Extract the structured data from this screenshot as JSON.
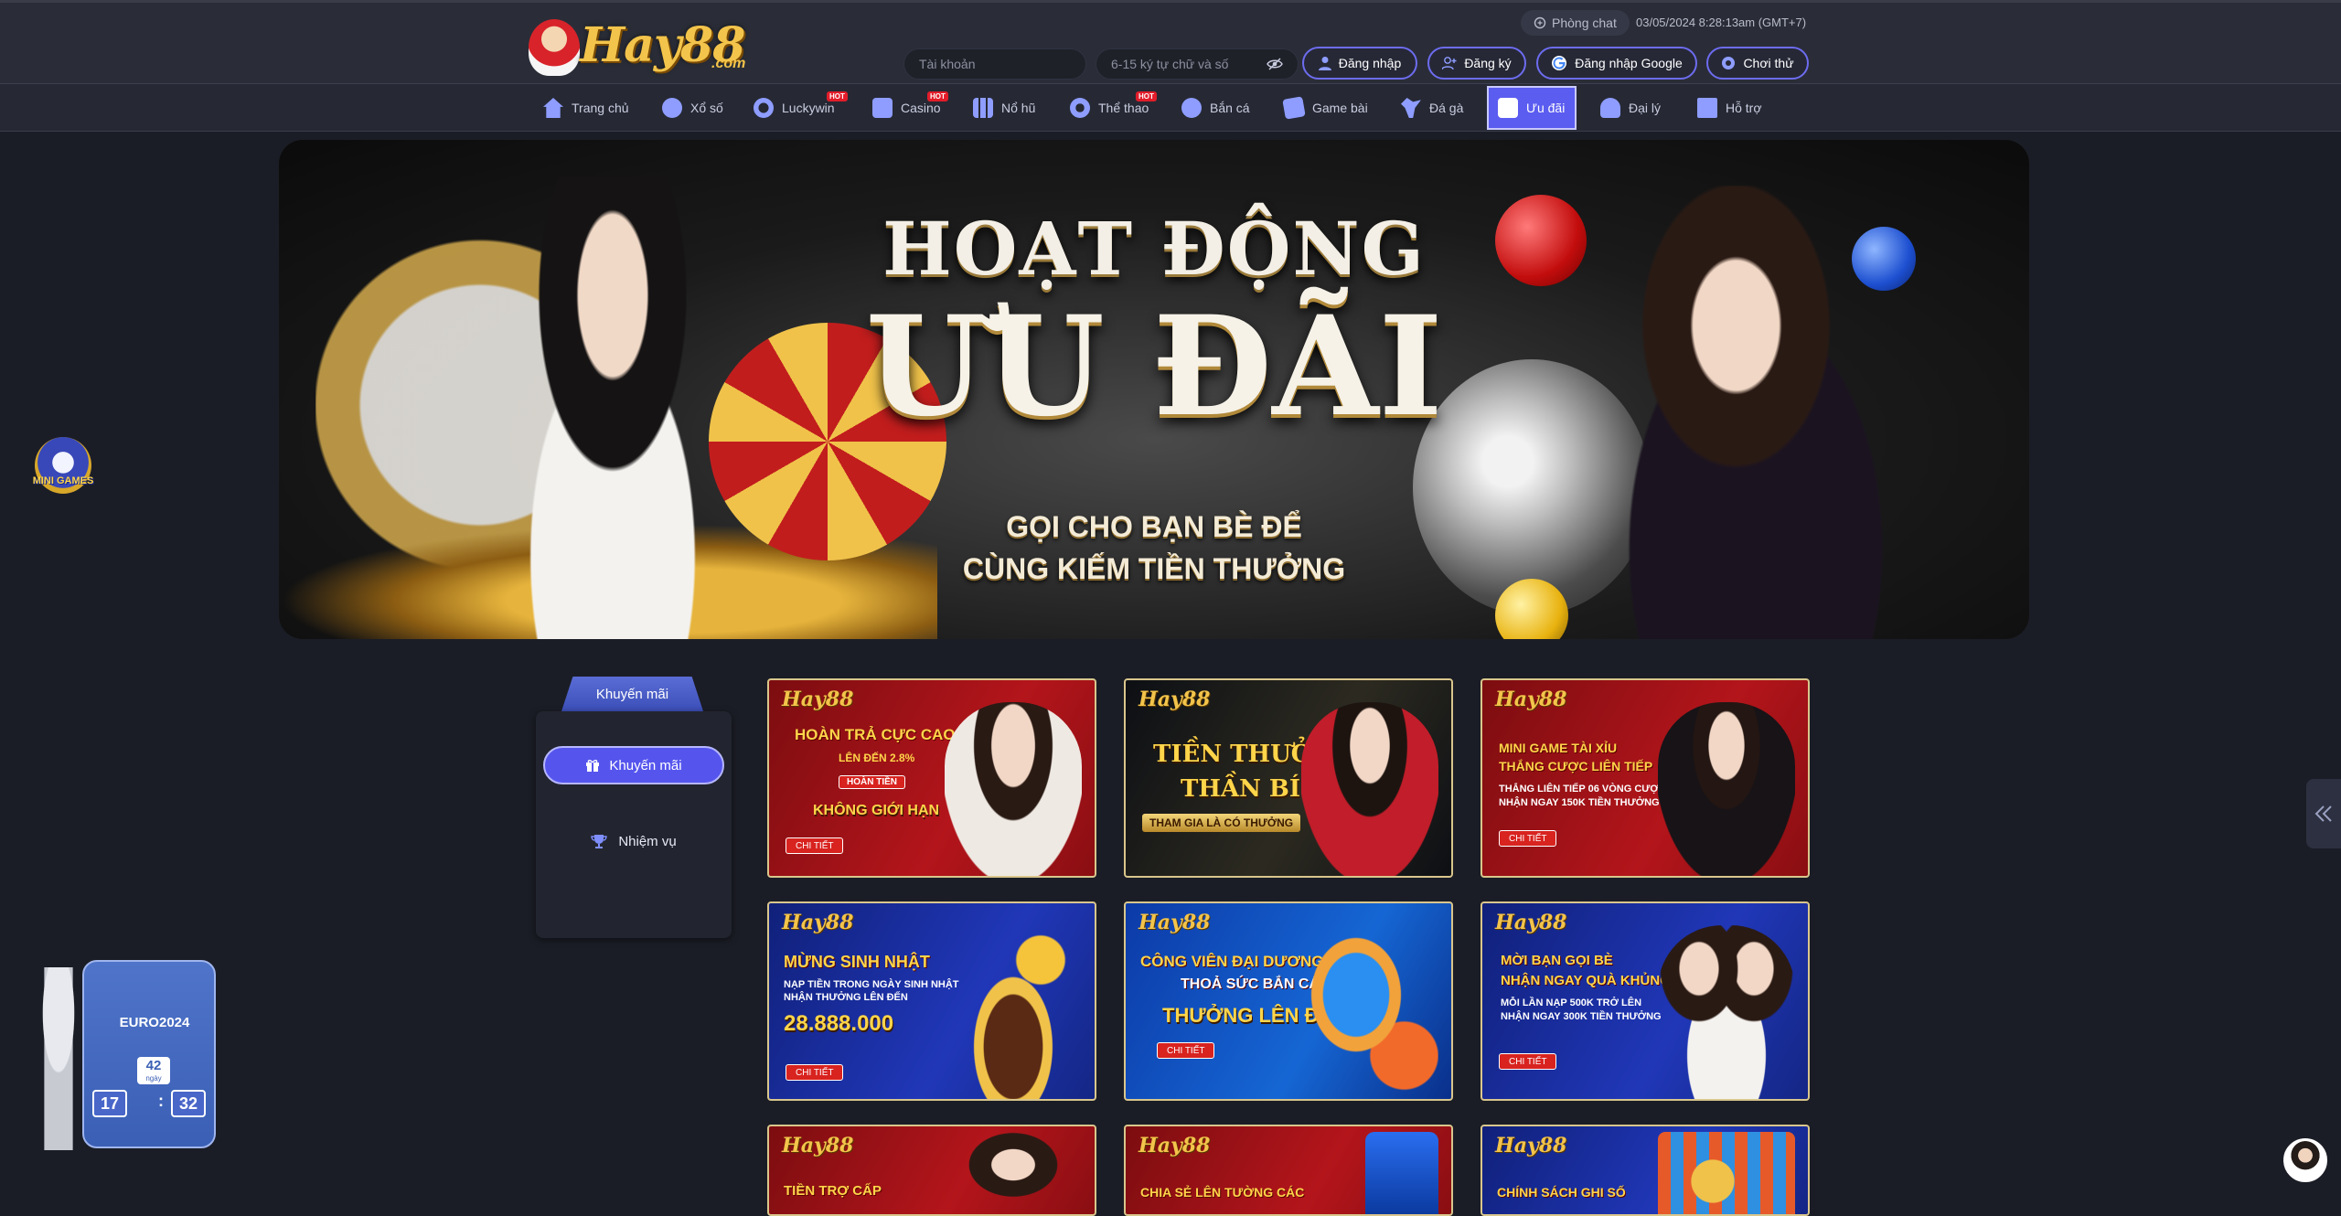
{
  "header": {
    "logo_text": "Hay88",
    "logo_domain": ".com",
    "chat_label": "Phòng chat",
    "clock": "03/05/2024 8:28:13am  (GMT+7)",
    "username_placeholder": "Tài khoản",
    "password_placeholder": "6-15 ký tự chữ và số",
    "login_label": "Đăng nhập",
    "register_label": "Đăng ký",
    "google_label": "Đăng nhập Google",
    "trial_label": "Chơi thử"
  },
  "nav": {
    "items": [
      {
        "label": "Trang chủ",
        "hot": false
      },
      {
        "label": "Xổ số",
        "hot": false
      },
      {
        "label": "Luckywin",
        "hot": true
      },
      {
        "label": "Casino",
        "hot": true
      },
      {
        "label": "Nổ hũ",
        "hot": false
      },
      {
        "label": "Thể thao",
        "hot": true
      },
      {
        "label": "Bắn cá",
        "hot": false
      },
      {
        "label": "Game bài",
        "hot": false
      },
      {
        "label": "Đá gà",
        "hot": false
      },
      {
        "label": "Ưu đãi",
        "hot": false,
        "active": true
      },
      {
        "label": "Đại lý",
        "hot": false
      },
      {
        "label": "Hỗ trợ",
        "hot": false
      }
    ],
    "hot_badge": "HOT"
  },
  "banner": {
    "title_line1": "HOẠT ĐỘNG",
    "title_line2": "ƯU ĐÃI",
    "subtitle_line1": "GỌI CHO BẠN BÈ ĐỂ",
    "subtitle_line2": "CÙNG KIẾM TIỀN THƯỞNG"
  },
  "sidebar": {
    "tab_label": "Khuyến mãi",
    "items": [
      {
        "label": "Khuyến mãi",
        "active": true
      },
      {
        "label": "Nhiệm vụ",
        "active": false
      }
    ]
  },
  "promos": [
    {
      "logo": "Hay88",
      "line1": "HOÀN TRẢ CỰC CAO",
      "line2": "LÊN ĐẾN 2.8%",
      "big": "KHÔNG GIỚI HẠN",
      "tag": "HOÀN TIỀN",
      "cta": "CHI TIẾT"
    },
    {
      "logo": "Hay88",
      "line1": "TIỀN THƯỞNG",
      "line2": "THẦN BÍ",
      "big": "THAM GIA LÀ CÓ THƯỞNG",
      "tag": "",
      "cta": ""
    },
    {
      "logo": "Hay88",
      "line1": "MINI GAME TÀI XỈU",
      "line2": "THẮNG CƯỢC LIÊN TIẾP",
      "big": "THẮNG LIÊN TIẾP 06 VÒNG CƯỢC NHẬN NGAY 150K TIỀN THƯỞNG",
      "tag": "",
      "cta": "CHI TIẾT"
    },
    {
      "logo": "Hay88",
      "line1": "MỪNG SINH NHẬT",
      "line2": "NẠP TIỀN TRONG NGÀY SINH NHẬT NHẬN THƯỞNG LÊN ĐẾN",
      "big": "28.888.000",
      "tag": "",
      "cta": "CHI TIẾT"
    },
    {
      "logo": "Hay88",
      "line1": "CÔNG VIÊN ĐẠI DƯƠNG",
      "line2": "THOẢ SỨC BẮN CÁ",
      "big": "THƯỞNG LÊN ĐẾN 50%",
      "tag": "",
      "cta": "CHI TIẾT"
    },
    {
      "logo": "Hay88",
      "line1": "MỜI BẠN GỌI BÈ",
      "line2": "NHẬN NGAY QUÀ KHỦNG",
      "big": "MỖI LẦN NẠP 500K TRỞ LÊN NHẬN NGAY 300K TIỀN THƯỞNG",
      "tag": "",
      "cta": "CHI TIẾT"
    },
    {
      "logo": "Hay88",
      "line1": "TIỀN TRỢ CẤP",
      "line2": "",
      "big": "",
      "tag": "",
      "cta": ""
    },
    {
      "logo": "Hay88",
      "line1": "CHIA SẺ LÊN TƯỜNG CÁC",
      "line2": "",
      "big": "",
      "tag": "",
      "cta": ""
    },
    {
      "logo": "Hay88",
      "line1": "CHÍNH SÁCH GHI SỐ",
      "line2": "",
      "big": "",
      "tag": "",
      "cta": ""
    }
  ],
  "widgets": {
    "minigame_label": "MINI GAMES",
    "euro_title": "EURO2024",
    "euro_days": "42",
    "euro_days_unit": "ngày",
    "euro_hours": "17",
    "euro_minutes": "32",
    "sidetab_icon": "double-chevron-left-icon"
  },
  "colors": {
    "accent": "#5b5cf0",
    "background": "#1b1d26",
    "hot": "#e21c2a"
  }
}
